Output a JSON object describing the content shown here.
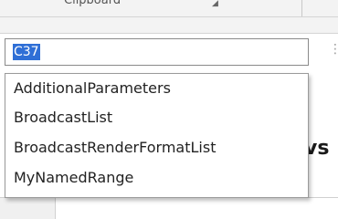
{
  "ribbon": {
    "group_label": "Clipboard",
    "dialog_launcher_glyph": "◢"
  },
  "namebox": {
    "value": "C37",
    "more_glyph": "⋮"
  },
  "named_ranges": {
    "items": [
      {
        "label": "AdditionalParameters"
      },
      {
        "label": "BroadcastList"
      },
      {
        "label": "BroadcastRenderFormatList"
      },
      {
        "label": "MyNamedRange"
      }
    ]
  },
  "sheet": {
    "partial_header_text": "vs"
  },
  "colors": {
    "selection": "#2f6fd6",
    "text": "#222222"
  }
}
